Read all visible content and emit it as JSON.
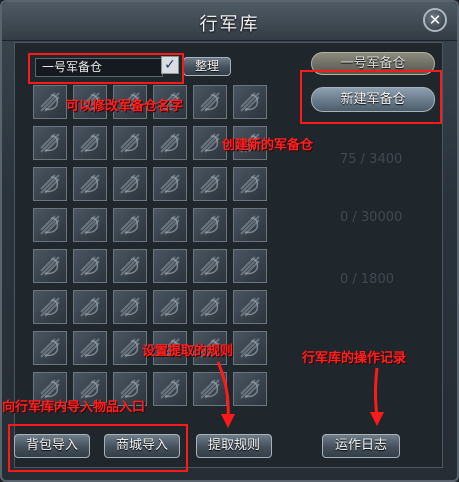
{
  "window": {
    "title": "行军库",
    "close_glyph": "✕"
  },
  "background_text": [
    "75 / 3400",
    "0 / 30000",
    "0 / 1800"
  ],
  "warehouse_name": {
    "value": "一号军备仓",
    "checked": true,
    "check_glyph": "✓"
  },
  "buttons": {
    "sort": "整理",
    "warehouse_1": "一号军备仓",
    "new_warehouse": "新建军备仓",
    "backpack_import": "背包导入",
    "mall_import": "商城导入",
    "extract_rules": "提取规则",
    "operation_log": "运作日志"
  },
  "grid": {
    "rows": 8,
    "cols": 6,
    "slot_icon": "empty-slot-icon"
  },
  "annotations": {
    "rename": "可以修改军备仓名字",
    "create": "创建新的军备仓",
    "rules": "设置提取的规则",
    "log": "行军库的操作记录",
    "import": "向行军库内导入物品入口"
  },
  "colors": {
    "annotation": "#ff1a1a",
    "window_bg": "#2a333c"
  }
}
